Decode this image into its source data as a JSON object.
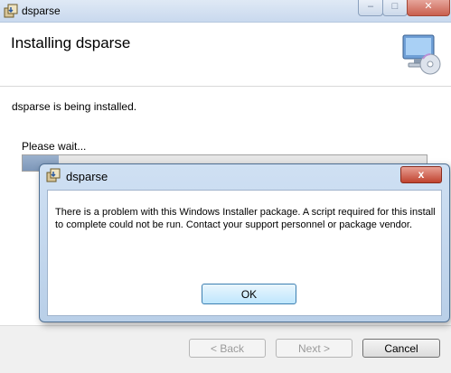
{
  "window": {
    "title": "dsparse",
    "controls": {
      "minimize": "–",
      "maximize": "□",
      "close": "✕"
    }
  },
  "header": {
    "title": "Installing dsparse"
  },
  "main": {
    "status_text": "dsparse is being installed.",
    "wait_text": "Please wait...",
    "progress_fraction": 0.09
  },
  "footer": {
    "back_label": "< Back",
    "next_label": "Next >",
    "cancel_label": "Cancel"
  },
  "dialog": {
    "title": "dsparse",
    "close_glyph": "x",
    "message": "There is a problem with this Windows Installer package. A script required for this install to complete could not be run. Contact your support personnel or package vendor.",
    "ok_label": "OK"
  },
  "icons": {
    "app": "installer-package-icon",
    "header": "computer-cd-icon",
    "dialog": "installer-package-icon"
  },
  "colors": {
    "progress": "#8aa3c4",
    "dialog_frame": "#c6d9ef",
    "close_red": "#c9604f"
  }
}
